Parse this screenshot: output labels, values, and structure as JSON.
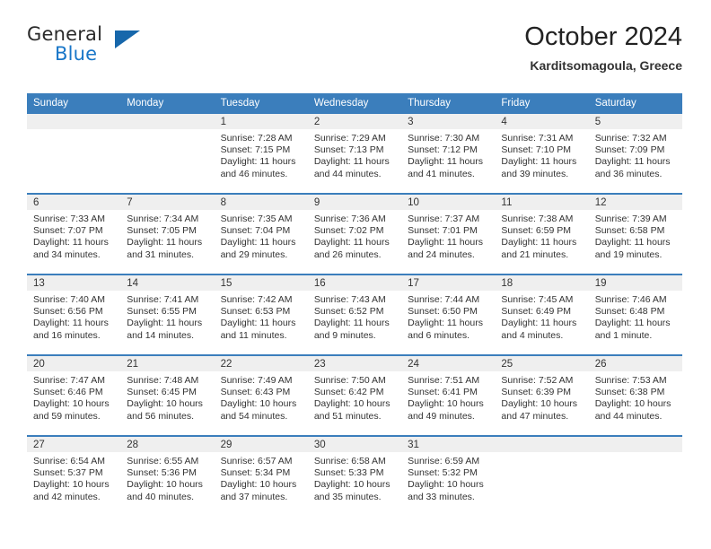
{
  "brand": {
    "name_part1": "General",
    "name_part2": "Blue",
    "triangle_color": "#1767ab",
    "blue_color": "#1876c8"
  },
  "header": {
    "title": "October 2024",
    "subtitle": "Karditsomagoula, Greece",
    "accent_color": "#3b7ebc",
    "date_band_color": "#efefef"
  },
  "weekdays": [
    "Sunday",
    "Monday",
    "Tuesday",
    "Wednesday",
    "Thursday",
    "Friday",
    "Saturday"
  ],
  "weeks": [
    [
      {
        "day": "",
        "sunrise": "",
        "sunset": "",
        "daylight_line1": "",
        "daylight_line2": ""
      },
      {
        "day": "",
        "sunrise": "",
        "sunset": "",
        "daylight_line1": "",
        "daylight_line2": ""
      },
      {
        "day": "1",
        "sunrise": "Sunrise: 7:28 AM",
        "sunset": "Sunset: 7:15 PM",
        "daylight_line1": "Daylight: 11 hours",
        "daylight_line2": "and 46 minutes."
      },
      {
        "day": "2",
        "sunrise": "Sunrise: 7:29 AM",
        "sunset": "Sunset: 7:13 PM",
        "daylight_line1": "Daylight: 11 hours",
        "daylight_line2": "and 44 minutes."
      },
      {
        "day": "3",
        "sunrise": "Sunrise: 7:30 AM",
        "sunset": "Sunset: 7:12 PM",
        "daylight_line1": "Daylight: 11 hours",
        "daylight_line2": "and 41 minutes."
      },
      {
        "day": "4",
        "sunrise": "Sunrise: 7:31 AM",
        "sunset": "Sunset: 7:10 PM",
        "daylight_line1": "Daylight: 11 hours",
        "daylight_line2": "and 39 minutes."
      },
      {
        "day": "5",
        "sunrise": "Sunrise: 7:32 AM",
        "sunset": "Sunset: 7:09 PM",
        "daylight_line1": "Daylight: 11 hours",
        "daylight_line2": "and 36 minutes."
      }
    ],
    [
      {
        "day": "6",
        "sunrise": "Sunrise: 7:33 AM",
        "sunset": "Sunset: 7:07 PM",
        "daylight_line1": "Daylight: 11 hours",
        "daylight_line2": "and 34 minutes."
      },
      {
        "day": "7",
        "sunrise": "Sunrise: 7:34 AM",
        "sunset": "Sunset: 7:05 PM",
        "daylight_line1": "Daylight: 11 hours",
        "daylight_line2": "and 31 minutes."
      },
      {
        "day": "8",
        "sunrise": "Sunrise: 7:35 AM",
        "sunset": "Sunset: 7:04 PM",
        "daylight_line1": "Daylight: 11 hours",
        "daylight_line2": "and 29 minutes."
      },
      {
        "day": "9",
        "sunrise": "Sunrise: 7:36 AM",
        "sunset": "Sunset: 7:02 PM",
        "daylight_line1": "Daylight: 11 hours",
        "daylight_line2": "and 26 minutes."
      },
      {
        "day": "10",
        "sunrise": "Sunrise: 7:37 AM",
        "sunset": "Sunset: 7:01 PM",
        "daylight_line1": "Daylight: 11 hours",
        "daylight_line2": "and 24 minutes."
      },
      {
        "day": "11",
        "sunrise": "Sunrise: 7:38 AM",
        "sunset": "Sunset: 6:59 PM",
        "daylight_line1": "Daylight: 11 hours",
        "daylight_line2": "and 21 minutes."
      },
      {
        "day": "12",
        "sunrise": "Sunrise: 7:39 AM",
        "sunset": "Sunset: 6:58 PM",
        "daylight_line1": "Daylight: 11 hours",
        "daylight_line2": "and 19 minutes."
      }
    ],
    [
      {
        "day": "13",
        "sunrise": "Sunrise: 7:40 AM",
        "sunset": "Sunset: 6:56 PM",
        "daylight_line1": "Daylight: 11 hours",
        "daylight_line2": "and 16 minutes."
      },
      {
        "day": "14",
        "sunrise": "Sunrise: 7:41 AM",
        "sunset": "Sunset: 6:55 PM",
        "daylight_line1": "Daylight: 11 hours",
        "daylight_line2": "and 14 minutes."
      },
      {
        "day": "15",
        "sunrise": "Sunrise: 7:42 AM",
        "sunset": "Sunset: 6:53 PM",
        "daylight_line1": "Daylight: 11 hours",
        "daylight_line2": "and 11 minutes."
      },
      {
        "day": "16",
        "sunrise": "Sunrise: 7:43 AM",
        "sunset": "Sunset: 6:52 PM",
        "daylight_line1": "Daylight: 11 hours",
        "daylight_line2": "and 9 minutes."
      },
      {
        "day": "17",
        "sunrise": "Sunrise: 7:44 AM",
        "sunset": "Sunset: 6:50 PM",
        "daylight_line1": "Daylight: 11 hours",
        "daylight_line2": "and 6 minutes."
      },
      {
        "day": "18",
        "sunrise": "Sunrise: 7:45 AM",
        "sunset": "Sunset: 6:49 PM",
        "daylight_line1": "Daylight: 11 hours",
        "daylight_line2": "and 4 minutes."
      },
      {
        "day": "19",
        "sunrise": "Sunrise: 7:46 AM",
        "sunset": "Sunset: 6:48 PM",
        "daylight_line1": "Daylight: 11 hours",
        "daylight_line2": "and 1 minute."
      }
    ],
    [
      {
        "day": "20",
        "sunrise": "Sunrise: 7:47 AM",
        "sunset": "Sunset: 6:46 PM",
        "daylight_line1": "Daylight: 10 hours",
        "daylight_line2": "and 59 minutes."
      },
      {
        "day": "21",
        "sunrise": "Sunrise: 7:48 AM",
        "sunset": "Sunset: 6:45 PM",
        "daylight_line1": "Daylight: 10 hours",
        "daylight_line2": "and 56 minutes."
      },
      {
        "day": "22",
        "sunrise": "Sunrise: 7:49 AM",
        "sunset": "Sunset: 6:43 PM",
        "daylight_line1": "Daylight: 10 hours",
        "daylight_line2": "and 54 minutes."
      },
      {
        "day": "23",
        "sunrise": "Sunrise: 7:50 AM",
        "sunset": "Sunset: 6:42 PM",
        "daylight_line1": "Daylight: 10 hours",
        "daylight_line2": "and 51 minutes."
      },
      {
        "day": "24",
        "sunrise": "Sunrise: 7:51 AM",
        "sunset": "Sunset: 6:41 PM",
        "daylight_line1": "Daylight: 10 hours",
        "daylight_line2": "and 49 minutes."
      },
      {
        "day": "25",
        "sunrise": "Sunrise: 7:52 AM",
        "sunset": "Sunset: 6:39 PM",
        "daylight_line1": "Daylight: 10 hours",
        "daylight_line2": "and 47 minutes."
      },
      {
        "day": "26",
        "sunrise": "Sunrise: 7:53 AM",
        "sunset": "Sunset: 6:38 PM",
        "daylight_line1": "Daylight: 10 hours",
        "daylight_line2": "and 44 minutes."
      }
    ],
    [
      {
        "day": "27",
        "sunrise": "Sunrise: 6:54 AM",
        "sunset": "Sunset: 5:37 PM",
        "daylight_line1": "Daylight: 10 hours",
        "daylight_line2": "and 42 minutes."
      },
      {
        "day": "28",
        "sunrise": "Sunrise: 6:55 AM",
        "sunset": "Sunset: 5:36 PM",
        "daylight_line1": "Daylight: 10 hours",
        "daylight_line2": "and 40 minutes."
      },
      {
        "day": "29",
        "sunrise": "Sunrise: 6:57 AM",
        "sunset": "Sunset: 5:34 PM",
        "daylight_line1": "Daylight: 10 hours",
        "daylight_line2": "and 37 minutes."
      },
      {
        "day": "30",
        "sunrise": "Sunrise: 6:58 AM",
        "sunset": "Sunset: 5:33 PM",
        "daylight_line1": "Daylight: 10 hours",
        "daylight_line2": "and 35 minutes."
      },
      {
        "day": "31",
        "sunrise": "Sunrise: 6:59 AM",
        "sunset": "Sunset: 5:32 PM",
        "daylight_line1": "Daylight: 10 hours",
        "daylight_line2": "and 33 minutes."
      },
      {
        "day": "",
        "sunrise": "",
        "sunset": "",
        "daylight_line1": "",
        "daylight_line2": ""
      },
      {
        "day": "",
        "sunrise": "",
        "sunset": "",
        "daylight_line1": "",
        "daylight_line2": ""
      }
    ]
  ]
}
